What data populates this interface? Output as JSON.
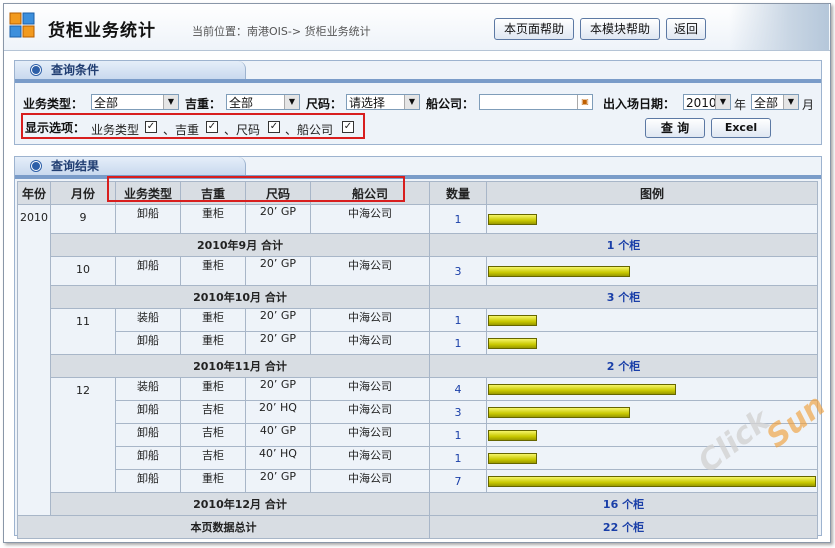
{
  "header": {
    "title": "货柜业务统计",
    "location": "当前位置：南港OIS-> 货柜业务统计",
    "buttons": [
      "本页面帮助",
      "本模块帮助",
      "返回"
    ]
  },
  "query": {
    "panel_title": "查询条件",
    "business_type_label": "业务类型：",
    "business_type_value": "全部",
    "jizhong_label": "吉重：",
    "jizhong_value": "全部",
    "size_label": "尺码：",
    "size_value": "请选择",
    "shipco_label": "船公司：",
    "shipco_value": "",
    "date_label": "出入场日期：",
    "year_value": "2010",
    "year_unit": "年",
    "month_value": "全部",
    "month_unit": "月",
    "display_label": "显示选项：",
    "display_options": [
      "业务类型",
      "、吉重",
      "、尺码",
      "、船公司"
    ],
    "query_button": "查 询",
    "excel_button": "Excel"
  },
  "results": {
    "panel_title": "查询结果",
    "columns": [
      "年份",
      "月份",
      "业务类型",
      "吉重",
      "尺码",
      "船公司",
      "数量",
      "图例"
    ],
    "year": "2010",
    "months": [
      {
        "month": "9",
        "rows": [
          {
            "type": "卸船",
            "jz": "重柜",
            "size": "20’ GP",
            "co": "中海公司",
            "qty": "1"
          }
        ],
        "subtotal_label": "2010年9月 合计",
        "subtotal_value": "1",
        "subtotal_unit": "个柜"
      },
      {
        "month": "10",
        "rows": [
          {
            "type": "卸船",
            "jz": "重柜",
            "size": "20’ GP",
            "co": "中海公司",
            "qty": "3"
          }
        ],
        "subtotal_label": "2010年10月 合计",
        "subtotal_value": "3",
        "subtotal_unit": "个柜"
      },
      {
        "month": "11",
        "rows": [
          {
            "type": "装船",
            "jz": "重柜",
            "size": "20’ GP",
            "co": "中海公司",
            "qty": "1"
          },
          {
            "type": "卸船",
            "jz": "重柜",
            "size": "20’ GP",
            "co": "中海公司",
            "qty": "1"
          }
        ],
        "subtotal_label": "2010年11月 合计",
        "subtotal_value": "2",
        "subtotal_unit": "个柜"
      },
      {
        "month": "12",
        "rows": [
          {
            "type": "装船",
            "jz": "重柜",
            "size": "20’ GP",
            "co": "中海公司",
            "qty": "4"
          },
          {
            "type": "卸船",
            "jz": "吉柜",
            "size": "20’ HQ",
            "co": "中海公司",
            "qty": "3"
          },
          {
            "type": "卸船",
            "jz": "吉柜",
            "size": "40’ GP",
            "co": "中海公司",
            "qty": "1"
          },
          {
            "type": "卸船",
            "jz": "吉柜",
            "size": "40’ HQ",
            "co": "中海公司",
            "qty": "1"
          },
          {
            "type": "卸船",
            "jz": "重柜",
            "size": "20’ GP",
            "co": "中海公司",
            "qty": "7"
          }
        ],
        "subtotal_label": "2010年12月 合计",
        "subtotal_value": "16",
        "subtotal_unit": "个柜"
      }
    ],
    "total_label": "本页数据总计",
    "total_value": "22",
    "total_unit": "个柜"
  }
}
